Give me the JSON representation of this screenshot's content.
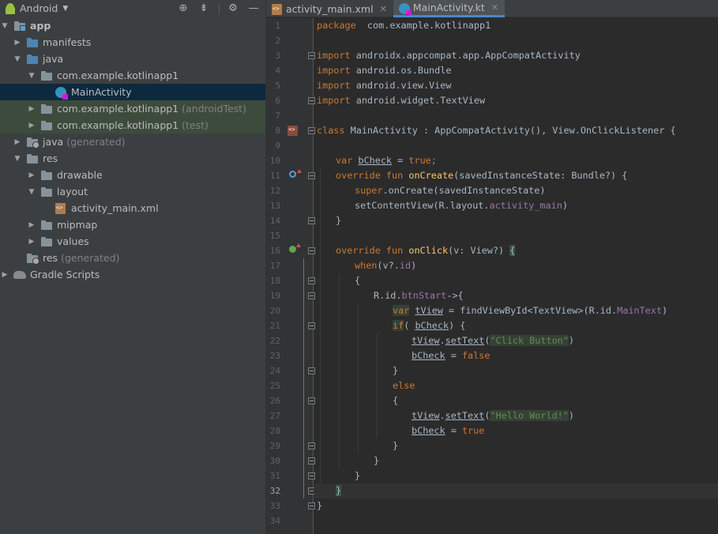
{
  "project_panel": {
    "title": "Android",
    "tree": [
      {
        "label": "app",
        "suffix": "",
        "depth": 0,
        "toggle": "open",
        "icon": "module-folder",
        "bold": true
      },
      {
        "label": "manifests",
        "suffix": "",
        "depth": 1,
        "toggle": "closed",
        "icon": "folder-blue"
      },
      {
        "label": "java",
        "suffix": "",
        "depth": 1,
        "toggle": "open",
        "icon": "folder-blue"
      },
      {
        "label": "com.example.kotlinapp1",
        "suffix": "",
        "depth": 2,
        "toggle": "open",
        "icon": "package"
      },
      {
        "label": "MainActivity",
        "suffix": "",
        "depth": 3,
        "toggle": "",
        "icon": "kotlin-class",
        "selected": true
      },
      {
        "label": "com.example.kotlinapp1",
        "suffix": "(androidTest)",
        "depth": 2,
        "toggle": "closed",
        "icon": "package",
        "test": true
      },
      {
        "label": "com.example.kotlinapp1",
        "suffix": "(test)",
        "depth": 2,
        "toggle": "closed",
        "icon": "package",
        "test": true
      },
      {
        "label": "java",
        "suffix": "(generated)",
        "depth": 1,
        "toggle": "closed",
        "icon": "folder-gen"
      },
      {
        "label": "res",
        "suffix": "",
        "depth": 1,
        "toggle": "open",
        "icon": "folder"
      },
      {
        "label": "drawable",
        "suffix": "",
        "depth": 2,
        "toggle": "closed",
        "icon": "folder"
      },
      {
        "label": "layout",
        "suffix": "",
        "depth": 2,
        "toggle": "open",
        "icon": "folder"
      },
      {
        "label": "activity_main.xml",
        "suffix": "",
        "depth": 3,
        "toggle": "",
        "icon": "xml-file"
      },
      {
        "label": "mipmap",
        "suffix": "",
        "depth": 2,
        "toggle": "closed",
        "icon": "folder"
      },
      {
        "label": "values",
        "suffix": "",
        "depth": 2,
        "toggle": "closed",
        "icon": "folder"
      },
      {
        "label": "res",
        "suffix": "(generated)",
        "depth": 1,
        "toggle": "",
        "icon": "folder-gen"
      },
      {
        "label": "Gradle Scripts",
        "suffix": "",
        "depth": 0,
        "toggle": "closed",
        "icon": "gradle"
      }
    ]
  },
  "editor": {
    "tabs": [
      {
        "label": "activity_main.xml",
        "icon": "xml-file",
        "active": false
      },
      {
        "label": "MainActivity.kt",
        "icon": "kotlin-class",
        "active": true
      }
    ],
    "current_line": 32,
    "lines": [
      {
        "n": 1,
        "indent": 0,
        "tokens": [
          [
            "kw",
            "package"
          ],
          [
            "",
            "  com.example.kotlinapp1"
          ]
        ]
      },
      {
        "n": 2,
        "indent": 0,
        "tokens": []
      },
      {
        "n": 3,
        "indent": 0,
        "tokens": [
          [
            "kw",
            "import"
          ],
          [
            "",
            " androidx.appcompat.app.AppCompatActivity"
          ]
        ]
      },
      {
        "n": 4,
        "indent": 0,
        "tokens": [
          [
            "kw",
            "import"
          ],
          [
            "",
            " android.os.Bundle"
          ]
        ]
      },
      {
        "n": 5,
        "indent": 0,
        "tokens": [
          [
            "kw",
            "import"
          ],
          [
            "",
            " android.view.View"
          ]
        ]
      },
      {
        "n": 6,
        "indent": 0,
        "tokens": [
          [
            "kw",
            "import"
          ],
          [
            "",
            " android.widget.TextView"
          ]
        ]
      },
      {
        "n": 7,
        "indent": 0,
        "tokens": []
      },
      {
        "n": 8,
        "indent": 0,
        "tokens": [
          [
            "kw",
            "class"
          ],
          [
            "",
            " MainActivity : AppCompatActivity(), View.OnClickListener {"
          ]
        ]
      },
      {
        "n": 9,
        "indent": 0,
        "tokens": []
      },
      {
        "n": 10,
        "indent": 1,
        "tokens": [
          [
            "kw",
            "var "
          ],
          [
            "var",
            "bCheck"
          ],
          [
            "",
            " = "
          ],
          [
            "kw",
            "true"
          ],
          [
            "kw",
            ";"
          ]
        ]
      },
      {
        "n": 11,
        "indent": 1,
        "tokens": [
          [
            "kw",
            "override fun "
          ],
          [
            "fn",
            "onCreate"
          ],
          [
            "",
            "(savedInstanceState: Bundle?) {"
          ]
        ]
      },
      {
        "n": 12,
        "indent": 2,
        "tokens": [
          [
            "kw",
            "super"
          ],
          [
            "",
            ".onCreate(savedInstanceState)"
          ]
        ]
      },
      {
        "n": 13,
        "indent": 2,
        "tokens": [
          [
            "",
            "setContentView(R.layout."
          ],
          [
            "prop",
            "activity_main"
          ],
          [
            "",
            ")"
          ]
        ]
      },
      {
        "n": 14,
        "indent": 1,
        "tokens": [
          [
            "",
            "}"
          ]
        ]
      },
      {
        "n": 15,
        "indent": 0,
        "tokens": []
      },
      {
        "n": 16,
        "indent": 1,
        "tokens": [
          [
            "kw",
            "override fun "
          ],
          [
            "fn",
            "onClick"
          ],
          [
            "",
            "(v: View?) "
          ],
          [
            "brk",
            "{"
          ]
        ]
      },
      {
        "n": 17,
        "indent": 2,
        "tokens": [
          [
            "kw",
            "when"
          ],
          [
            "",
            "(v?."
          ],
          [
            "prop",
            "id"
          ],
          [
            "",
            ")"
          ]
        ]
      },
      {
        "n": 18,
        "indent": 2,
        "tokens": [
          [
            "",
            "{"
          ]
        ]
      },
      {
        "n": 19,
        "indent": 3,
        "tokens": [
          [
            "",
            "R.id."
          ],
          [
            "prop",
            "btnStart"
          ],
          [
            "",
            "->{"
          ]
        ]
      },
      {
        "n": 20,
        "indent": 4,
        "tokens": [
          [
            "kw hlv",
            "var"
          ],
          [
            "",
            " "
          ],
          [
            "var",
            "tView"
          ],
          [
            "",
            " = findViewById<TextView>(R.id."
          ],
          [
            "prop",
            "MainText"
          ],
          [
            "",
            ")"
          ]
        ]
      },
      {
        "n": 21,
        "indent": 4,
        "tokens": [
          [
            "kw hlv",
            "if"
          ],
          [
            "",
            "( "
          ],
          [
            "var",
            "bCheck"
          ],
          [
            "",
            ") {"
          ]
        ]
      },
      {
        "n": 22,
        "indent": 5,
        "tokens": [
          [
            "var",
            "tView"
          ],
          [
            ".",
            ""
          ],
          [
            "var",
            "setText"
          ],
          [
            "",
            "("
          ],
          [
            "str hlv",
            "\"Click Button\""
          ],
          [
            "",
            ")"
          ]
        ]
      },
      {
        "n": 23,
        "indent": 5,
        "tokens": [
          [
            "var",
            "bCheck"
          ],
          [
            "",
            " = "
          ],
          [
            "kw",
            "false"
          ]
        ]
      },
      {
        "n": 24,
        "indent": 4,
        "tokens": [
          [
            "",
            "}"
          ]
        ]
      },
      {
        "n": 25,
        "indent": 4,
        "tokens": [
          [
            "kw",
            "else"
          ]
        ]
      },
      {
        "n": 26,
        "indent": 4,
        "tokens": [
          [
            "",
            "{"
          ]
        ]
      },
      {
        "n": 27,
        "indent": 5,
        "tokens": [
          [
            "var",
            "tView"
          ],
          [
            ".",
            ""
          ],
          [
            "var",
            "setText"
          ],
          [
            "",
            "("
          ],
          [
            "str hlv",
            "\"Hello World!\""
          ],
          [
            "",
            ")"
          ]
        ]
      },
      {
        "n": 28,
        "indent": 5,
        "tokens": [
          [
            "var",
            "bCheck"
          ],
          [
            "",
            " = "
          ],
          [
            "kw",
            "true"
          ]
        ]
      },
      {
        "n": 29,
        "indent": 4,
        "tokens": [
          [
            "",
            "}"
          ]
        ]
      },
      {
        "n": 30,
        "indent": 3,
        "tokens": [
          [
            "",
            "}"
          ]
        ]
      },
      {
        "n": 31,
        "indent": 2,
        "tokens": [
          [
            "",
            "}"
          ]
        ]
      },
      {
        "n": 32,
        "indent": 1,
        "tokens": [
          [
            "brk",
            "}"
          ]
        ]
      },
      {
        "n": 33,
        "indent": 0,
        "tokens": [
          [
            "",
            "}"
          ]
        ]
      },
      {
        "n": 34,
        "indent": 0,
        "tokens": []
      }
    ],
    "folds": [
      3,
      6,
      8,
      11,
      14,
      16,
      18,
      19,
      21,
      24,
      26,
      29,
      30,
      31,
      32,
      33
    ],
    "gutter_icons": [
      {
        "line": 8,
        "icon": "class-icon"
      },
      {
        "line": 11,
        "icon": "override-icon"
      },
      {
        "line": 16,
        "icon": "implement-icon"
      }
    ]
  }
}
